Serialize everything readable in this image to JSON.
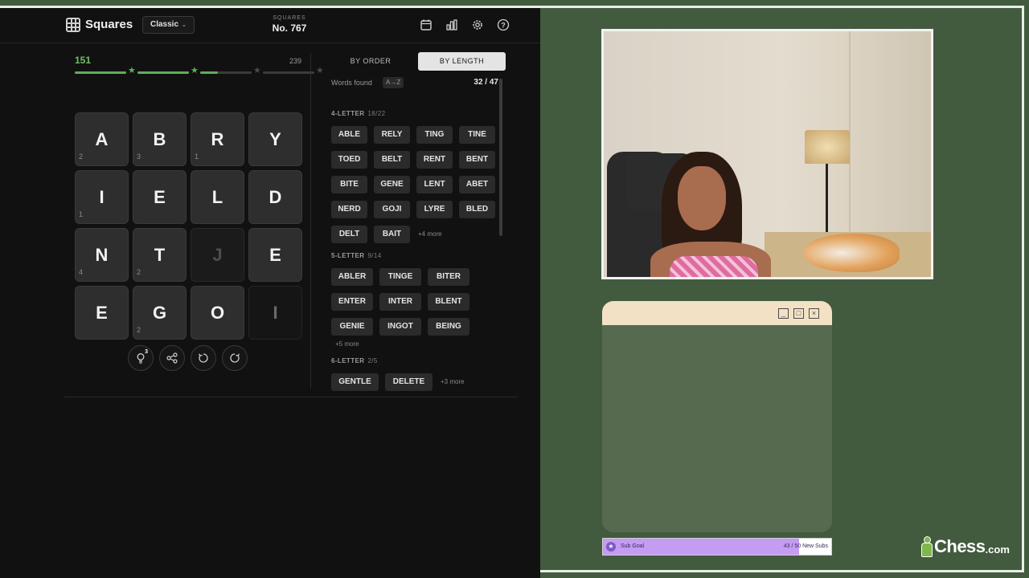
{
  "header": {
    "app_name": "Squares",
    "mode": "Classic",
    "puzzle_kicker": "SQUARES",
    "puzzle_number": "No. 767",
    "icons": [
      "calendar-icon",
      "stats-icon",
      "settings-icon",
      "help-icon"
    ]
  },
  "score": {
    "current": "151",
    "max": "239",
    "progress_fraction": 0.632
  },
  "board": {
    "tiles": [
      {
        "letter": "A",
        "count": "2",
        "state": "normal"
      },
      {
        "letter": "B",
        "count": "3",
        "state": "normal"
      },
      {
        "letter": "R",
        "count": "1",
        "state": "normal"
      },
      {
        "letter": "Y",
        "count": "",
        "state": "normal"
      },
      {
        "letter": "I",
        "count": "1",
        "state": "normal"
      },
      {
        "letter": "E",
        "count": "",
        "state": "normal"
      },
      {
        "letter": "L",
        "count": "",
        "state": "normal"
      },
      {
        "letter": "D",
        "count": "",
        "state": "normal"
      },
      {
        "letter": "N",
        "count": "4",
        "state": "normal"
      },
      {
        "letter": "T",
        "count": "2",
        "state": "normal"
      },
      {
        "letter": "J",
        "count": "",
        "state": "dim"
      },
      {
        "letter": "E",
        "count": "",
        "state": "normal"
      },
      {
        "letter": "E",
        "count": "",
        "state": "normal"
      },
      {
        "letter": "G",
        "count": "2",
        "state": "normal"
      },
      {
        "letter": "O",
        "count": "",
        "state": "normal"
      },
      {
        "letter": "I",
        "count": "",
        "state": "faint"
      }
    ],
    "hint_count": "3"
  },
  "words": {
    "tab_by_order": "BY ORDER",
    "tab_by_length": "BY LENGTH",
    "found_label": "Words found",
    "sort_label": "A→Z",
    "found_count": "32 / 47",
    "sections": [
      {
        "title": "4-LETTER",
        "fraction": "18/22",
        "words": [
          "ABLE",
          "RELY",
          "TING",
          "TINE",
          "TOED",
          "BELT",
          "RENT",
          "BENT",
          "BITE",
          "GENE",
          "LENT",
          "ABET",
          "NERD",
          "GOJI",
          "LYRE",
          "BLED",
          "DELT",
          "BAIT"
        ],
        "more": "+4 more"
      },
      {
        "title": "5-LETTER",
        "fraction": "9/14",
        "words": [
          "ABLER",
          "TINGE",
          "BITER",
          "ENTER",
          "INTER",
          "BLENT",
          "GENIE",
          "INGOT",
          "BEING"
        ],
        "more": "+5 more"
      },
      {
        "title": "6-LETTER",
        "fraction": "2/5",
        "words": [
          "GENTLE",
          "DELETE"
        ],
        "more": "+3 more"
      }
    ]
  },
  "sub_goal": {
    "label": "Sub Goal",
    "progress_text": "43 / 50 New Subs",
    "fraction": 0.86
  },
  "brand_logo": {
    "word": "Chess",
    "tld": ".com",
    "color": "#81b64c"
  },
  "colors": {
    "accent_green": "#5eae57",
    "background": "#425b3e",
    "game_bg": "#111111"
  }
}
